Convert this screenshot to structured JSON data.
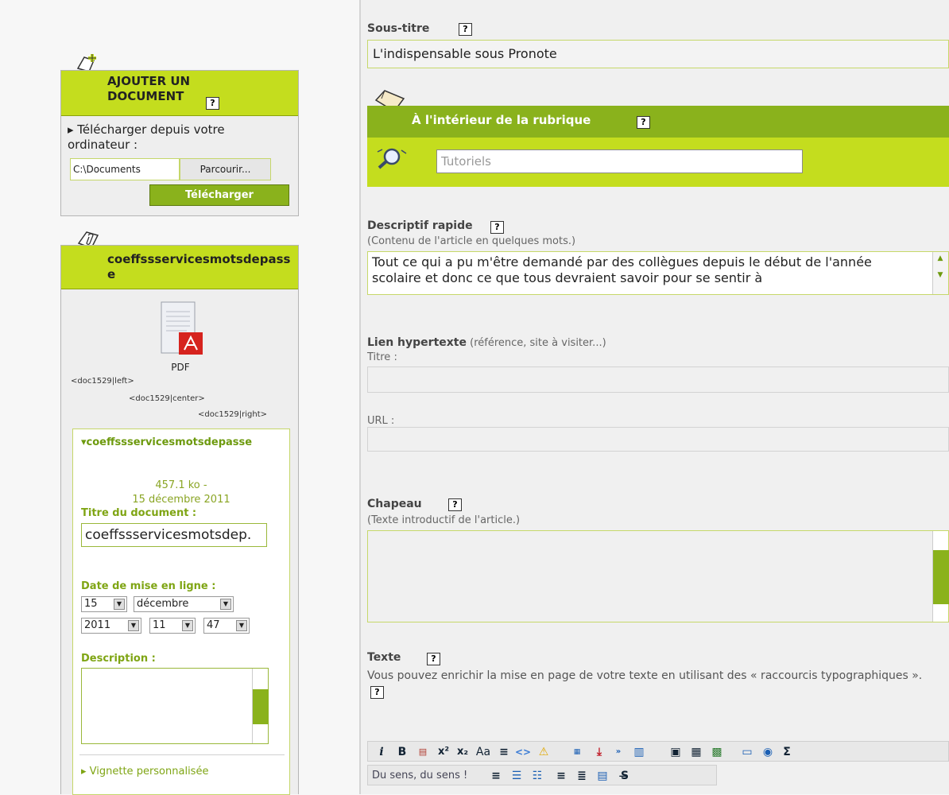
{
  "add_doc": {
    "title": "AJOUTER UN DOCUMENT",
    "upload_text": "▸ Télécharger depuis votre ordinateur :",
    "path_value": "C:\\Documents",
    "browse_label": "Parcourir...",
    "upload_button": "Télécharger"
  },
  "doc_box": {
    "title": "coeffssservicesmotsdepasse",
    "file_type": "PDF",
    "shortcode_left": "<doc1529|left>",
    "shortcode_center": "<doc1529|center>",
    "shortcode_right": "<doc1529|right>",
    "doc_name": "▾coeffssservicesmotsdepasse",
    "size": "457.1 ko -",
    "date": "15 décembre 2011",
    "title_label": "Titre du document :",
    "title_value": "coeffssservicesmotsdep.",
    "online_date_label": "Date de mise en ligne :",
    "day": "15",
    "month": "décembre",
    "year": "2011",
    "hour": "11",
    "minute": "47",
    "description_label": "Description :",
    "thumbnail_link": "▸ Vignette personnalisée"
  },
  "form": {
    "subtitle_label": "Sous-titre",
    "subtitle_value": "L'indispensable sous Pronote",
    "inside_rubric_label": "À l'intérieur de la rubrique",
    "rubric_value": "Tutoriels",
    "quick_desc_label": "Descriptif rapide",
    "quick_desc_hint": "(Contenu de l'article en quelques mots.)",
    "quick_desc_text": "Tout ce qui a pu m'être demandé par des collègues depuis le début de l'année scolaire et donc ce que tous devraient savoir pour se sentir à",
    "hyperlink_label": "Lien hypertexte",
    "hyperlink_hint": "(référence, site à visiter...)",
    "link_title_label": "Titre :",
    "url_label": "URL :",
    "chapeau_label": "Chapeau",
    "chapeau_hint": "(Texte introductif de l'article.)",
    "text_label": "Texte",
    "text_hint": "Vous pouvez enrichir la mise en page de votre texte en utilisant des « raccourcis typographiques ».",
    "toolbar_dropdown": "Du sens, du sens !"
  },
  "help_mark": "?",
  "colors": {
    "accent": "#c4dd1e",
    "accent_dark": "#8ab21c"
  }
}
